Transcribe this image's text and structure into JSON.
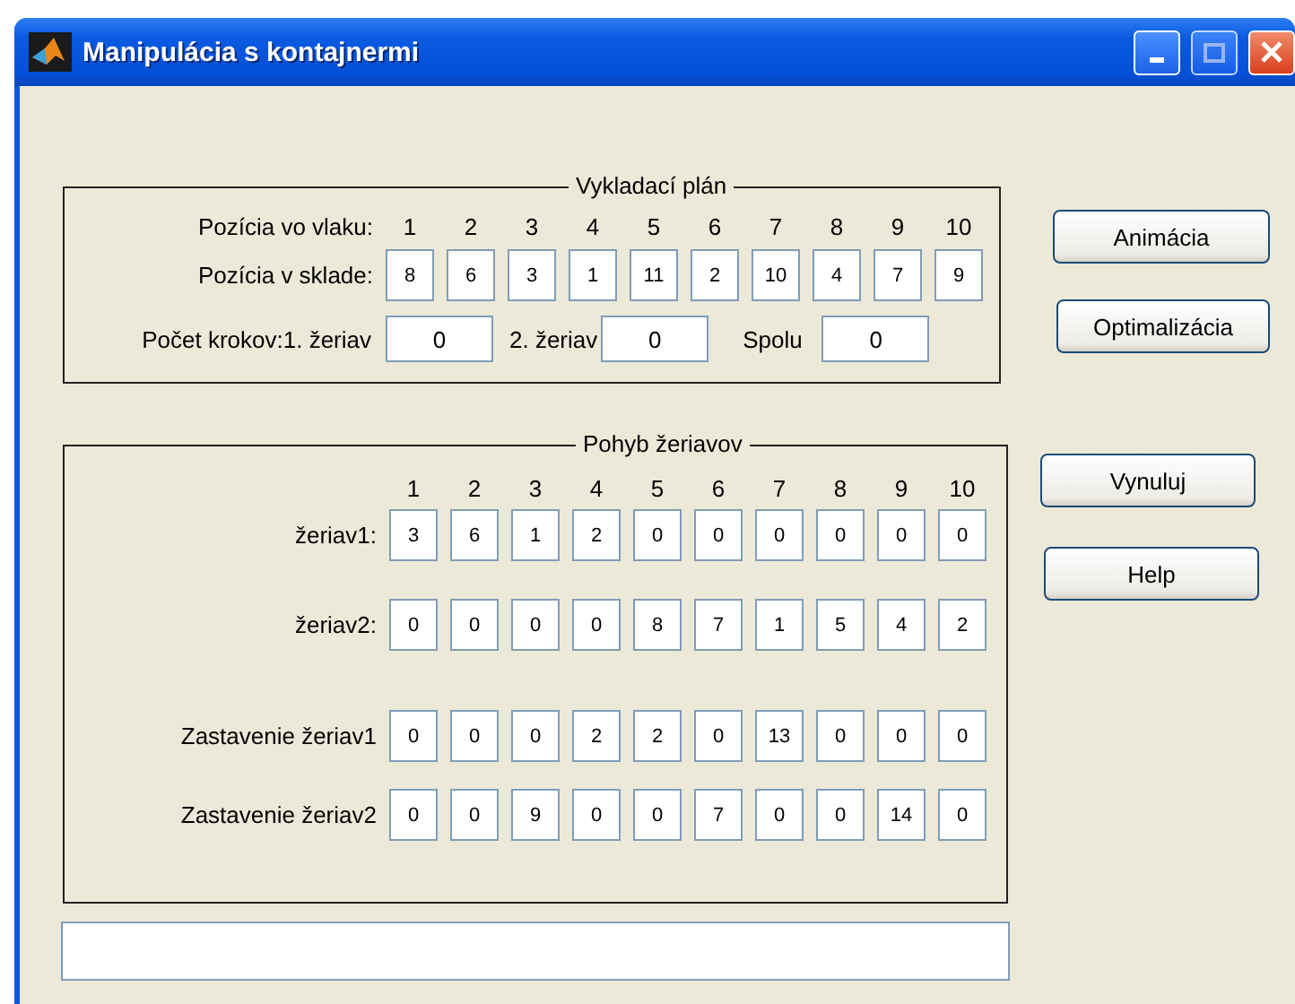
{
  "window": {
    "title": "Manipulácia s kontajnermi"
  },
  "unloading_plan": {
    "title": "Vykladací plán",
    "header_label": "Pozícia vo vlaku:",
    "column_headers": [
      "1",
      "2",
      "3",
      "4",
      "5",
      "6",
      "7",
      "8",
      "9",
      "10"
    ],
    "rows": [
      {
        "label": "Pozícia v sklade:",
        "values": [
          "8",
          "6",
          "3",
          "1",
          "11",
          "2",
          "10",
          "4",
          "7",
          "9"
        ]
      }
    ],
    "steps": [
      {
        "label": "Počet krokov:1. žeriav",
        "value": "0"
      },
      {
        "label": "2. žeriav",
        "value": "0"
      },
      {
        "label": "Spolu",
        "value": "0"
      }
    ]
  },
  "crane_movement": {
    "title": "Pohyb žeriavov",
    "column_headers": [
      "1",
      "2",
      "3",
      "4",
      "5",
      "6",
      "7",
      "8",
      "9",
      "10"
    ],
    "rows": [
      {
        "label": "žeriav1:",
        "values": [
          "3",
          "6",
          "1",
          "2",
          "0",
          "0",
          "0",
          "0",
          "0",
          "0"
        ]
      },
      {
        "label": "žeriav2:",
        "values": [
          "0",
          "0",
          "0",
          "0",
          "8",
          "7",
          "1",
          "5",
          "4",
          "2"
        ]
      },
      {
        "label": "Zastavenie žeriav1",
        "values": [
          "0",
          "0",
          "0",
          "2",
          "2",
          "0",
          "13",
          "0",
          "0",
          "0"
        ]
      },
      {
        "label": "Zastavenie žeriav2",
        "values": [
          "0",
          "0",
          "9",
          "0",
          "0",
          "7",
          "0",
          "0",
          "14",
          "0"
        ]
      }
    ]
  },
  "buttons": [
    "Animácia",
    "Optimalizácia",
    "Vynuluj",
    "Help"
  ]
}
